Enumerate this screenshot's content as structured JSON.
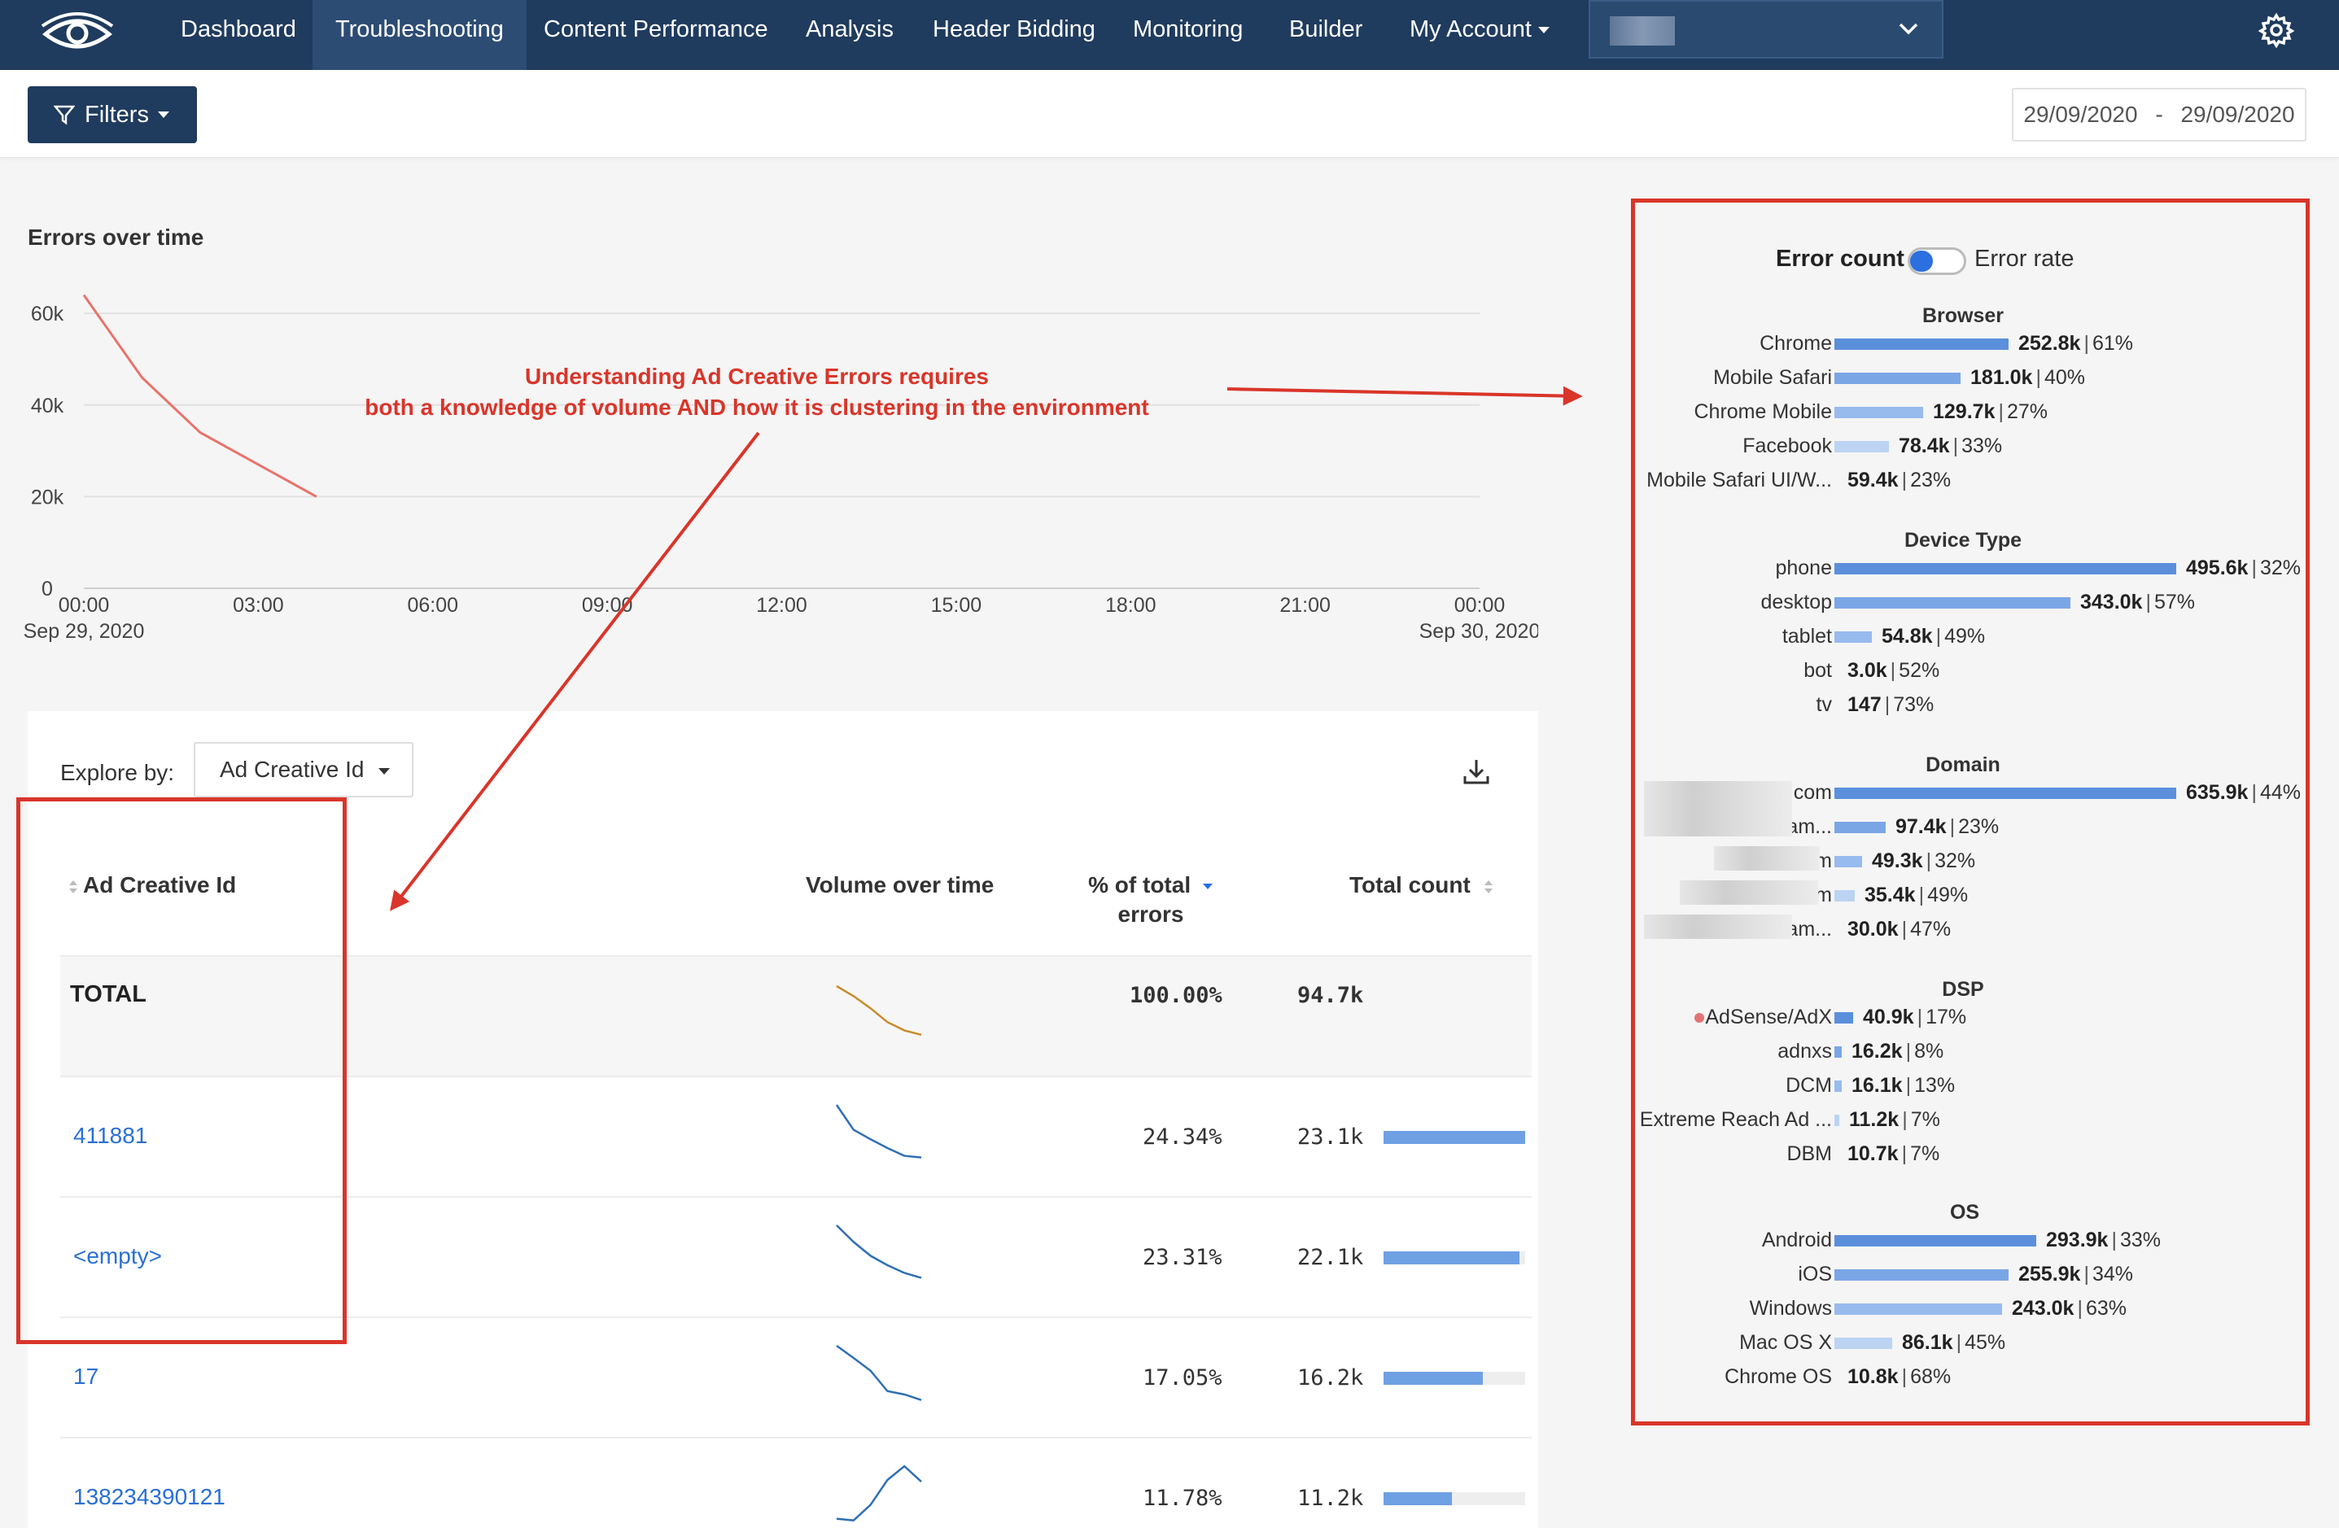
{
  "nav": {
    "items": [
      "Dashboard",
      "Troubleshooting",
      "Content Performance",
      "Analysis",
      "Header Bidding",
      "Monitoring",
      "Builder",
      "My Account"
    ],
    "active": "Troubleshooting"
  },
  "toolbar": {
    "filters_label": "Filters",
    "date_start": "29/09/2020",
    "date_sep": "-",
    "date_end": "29/09/2020"
  },
  "errors_chart": {
    "title": "Errors over time"
  },
  "chart_data": {
    "type": "line",
    "title": "Errors over time",
    "xlabel": "",
    "ylabel": "",
    "x_ticks": [
      "00:00\nSep 29, 2020",
      "03:00",
      "06:00",
      "09:00",
      "12:00",
      "15:00",
      "18:00",
      "21:00",
      "00:00\nSep 30, 2020"
    ],
    "y_ticks": [
      "0",
      "20k",
      "40k",
      "60k"
    ],
    "ylim": [
      0,
      65000
    ],
    "xlim_hours": [
      0,
      24
    ],
    "grid": true,
    "series": [
      {
        "color": "#e8736b",
        "x": [
          0,
          1,
          2,
          3,
          4
        ],
        "y": [
          64000,
          46000,
          34000,
          27000,
          20000
        ]
      }
    ]
  },
  "annotation": {
    "line1": "Understanding Ad Creative Errors requires",
    "line2": "both a knowledge of volume AND how it is clustering in the environment"
  },
  "table": {
    "explore_label": "Explore by:",
    "explore_value": "Ad Creative Id",
    "headers": {
      "id": "Ad Creative Id",
      "volume": "Volume over time",
      "pct_line1": "% of total",
      "pct_line2": "errors",
      "count": "Total count"
    },
    "total": {
      "label": "TOTAL",
      "pct": "100.00%",
      "count": "94.7k",
      "spark": [
        1.0,
        0.82,
        0.6,
        0.35,
        0.2,
        0.12
      ]
    },
    "rows": [
      {
        "id": "411881",
        "pct": "24.34%",
        "count": "23.1k",
        "share": 1.0,
        "spark": [
          1.0,
          0.55,
          0.38,
          0.22,
          0.08,
          0.05
        ]
      },
      {
        "id": "<empty>",
        "pct": "23.31%",
        "count": "22.1k",
        "share": 0.96,
        "spark": [
          1.0,
          0.7,
          0.45,
          0.28,
          0.14,
          0.05
        ]
      },
      {
        "id": "17",
        "pct": "17.05%",
        "count": "16.2k",
        "share": 0.7,
        "spark": [
          1.0,
          0.78,
          0.55,
          0.18,
          0.12,
          0.02
        ]
      },
      {
        "id": "138234390121",
        "pct": "11.78%",
        "count": "11.2k",
        "share": 0.48,
        "spark": [
          0.05,
          0.02,
          0.3,
          0.75,
          1.0,
          0.72
        ]
      }
    ]
  },
  "distribution": {
    "toggle_left": "Error count",
    "toggle_right": "Error rate",
    "groups": [
      {
        "title": "Browser",
        "items": [
          {
            "label": "Chrome",
            "value": "252.8k",
            "rate": "61%",
            "share": 0.51,
            "color": "#5b8fdc"
          },
          {
            "label": "Mobile Safari",
            "value": "181.0k",
            "rate": "40%",
            "share": 0.37,
            "color": "#7ba6e6"
          },
          {
            "label": "Chrome Mobile",
            "value": "129.7k",
            "rate": "27%",
            "share": 0.26,
            "color": "#98bbee"
          },
          {
            "label": "Facebook",
            "value": "78.4k",
            "rate": "33%",
            "share": 0.16,
            "color": "#bcd3f3"
          },
          {
            "label": "Mobile Safari UI/W...",
            "value": "59.4k",
            "rate": "23%",
            "share": 0.0,
            "color": "#d6e4f8"
          }
        ]
      },
      {
        "title": "Device Type",
        "items": [
          {
            "label": "phone",
            "value": "495.6k",
            "rate": "32%",
            "share": 1.0,
            "color": "#5b8fdc"
          },
          {
            "label": "desktop",
            "value": "343.0k",
            "rate": "57%",
            "share": 0.69,
            "color": "#7ba6e6"
          },
          {
            "label": "tablet",
            "value": "54.8k",
            "rate": "49%",
            "share": 0.11,
            "color": "#98bbee"
          },
          {
            "label": "bot",
            "value": "3.0k",
            "rate": "52%",
            "share": 0.0,
            "color": "#bcd3f3"
          },
          {
            "label": "tv",
            "value": "147",
            "rate": "73%",
            "share": 0.0,
            "color": "#d6e4f8"
          }
        ]
      },
      {
        "title": "Domain",
        "items": [
          {
            "label": ".com",
            "value": "635.9k",
            "rate": "44%",
            "share": 1.0,
            "color": "#5b8fdc",
            "blur": true
          },
          {
            "label": "am...",
            "value": "97.4k",
            "rate": "23%",
            "share": 0.15,
            "color": "#7ba6e6",
            "blur": true
          },
          {
            "label": ".com",
            "value": "49.3k",
            "rate": "32%",
            "share": 0.08,
            "color": "#98bbee",
            "blur": true
          },
          {
            "label": ".com",
            "value": "35.4k",
            "rate": "49%",
            "share": 0.06,
            "color": "#bcd3f3",
            "blur": true
          },
          {
            "label": "am...",
            "value": "30.0k",
            "rate": "47%",
            "share": 0.0,
            "color": "#d6e4f8",
            "blur": true
          }
        ]
      },
      {
        "title": "DSP",
        "items": [
          {
            "label": "AdSense/AdX",
            "value": "40.9k",
            "rate": "17%",
            "share": 0.054,
            "color": "#5b8fdc",
            "dot": true
          },
          {
            "label": "adnxs",
            "value": "16.2k",
            "rate": "8%",
            "share": 0.022,
            "color": "#7ba6e6"
          },
          {
            "label": "DCM",
            "value": "16.1k",
            "rate": "13%",
            "share": 0.022,
            "color": "#98bbee"
          },
          {
            "label": "Extreme Reach Ad ...",
            "value": "11.2k",
            "rate": "7%",
            "share": 0.015,
            "color": "#bcd3f3"
          },
          {
            "label": "DBM",
            "value": "10.7k",
            "rate": "7%",
            "share": 0.0,
            "color": "#d6e4f8"
          }
        ]
      },
      {
        "title": "OS",
        "items": [
          {
            "label": "Android",
            "value": "293.9k",
            "rate": "33%",
            "share": 0.59,
            "color": "#5b8fdc"
          },
          {
            "label": "iOS",
            "value": "255.9k",
            "rate": "34%",
            "share": 0.51,
            "color": "#7ba6e6"
          },
          {
            "label": "Windows",
            "value": "243.0k",
            "rate": "63%",
            "share": 0.49,
            "color": "#98bbee"
          },
          {
            "label": "Mac OS X",
            "value": "86.1k",
            "rate": "45%",
            "share": 0.17,
            "color": "#bcd3f3"
          },
          {
            "label": "Chrome OS",
            "value": "10.8k",
            "rate": "68%",
            "share": 0.0,
            "color": "#d6e4f8"
          }
        ]
      }
    ]
  }
}
